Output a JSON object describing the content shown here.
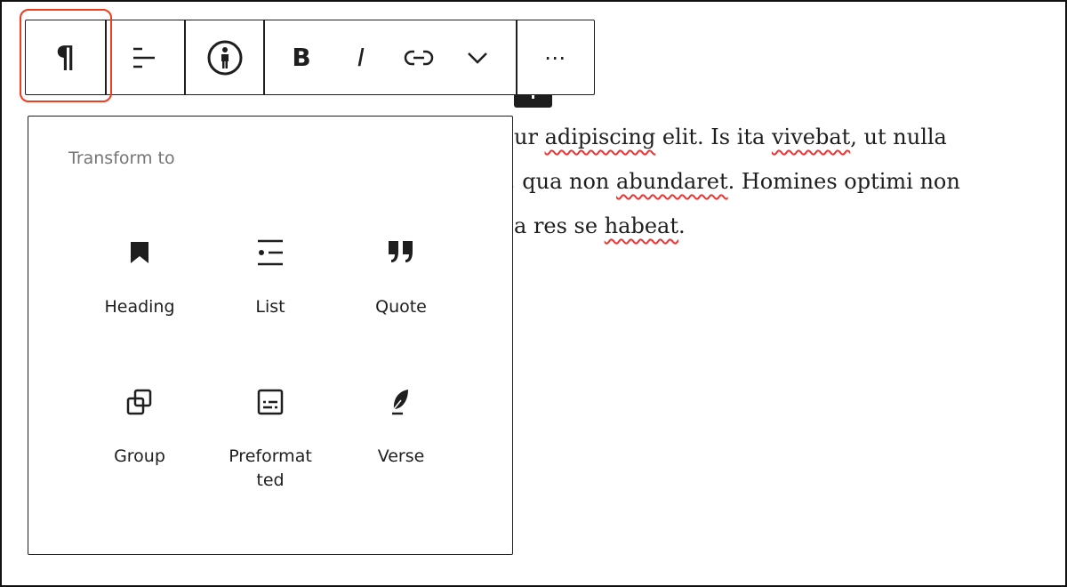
{
  "toolbar": {
    "buttons": [
      {
        "name": "paragraph",
        "icon": "pilcrow-icon",
        "label": "¶"
      },
      {
        "name": "align",
        "icon": "align-left-icon"
      },
      {
        "name": "accessibility",
        "icon": "accessibility-icon"
      },
      {
        "name": "bold",
        "label": "B"
      },
      {
        "name": "italic",
        "label": "I"
      },
      {
        "name": "link",
        "icon": "link-icon"
      },
      {
        "name": "more-rich-text",
        "icon": "chevron-down-icon"
      },
      {
        "name": "options",
        "label": "⋯"
      }
    ],
    "highlight_color": "#f03c1f"
  },
  "paragraph": {
    "line1": [
      "ur ",
      "adipiscing",
      " elit. Is ita ",
      "vivebat",
      ", ut nulla"
    ],
    "line2": [
      ", qua non ",
      "abundaret",
      ". Homines optimi non"
    ],
    "line3": [
      "a res se ",
      "habeat",
      "."
    ]
  },
  "popover": {
    "title": "Transform to",
    "items": [
      {
        "label": "Heading",
        "icon": "bookmark-heading-icon"
      },
      {
        "label": "List",
        "icon": "list-icon"
      },
      {
        "label": "Quote",
        "icon": "quote-icon"
      },
      {
        "label": "Group",
        "icon": "group-icon"
      },
      {
        "label": "Preformat\nted",
        "icon": "preformatted-icon"
      },
      {
        "label": "Verse",
        "icon": "feather-verse-icon"
      }
    ]
  }
}
